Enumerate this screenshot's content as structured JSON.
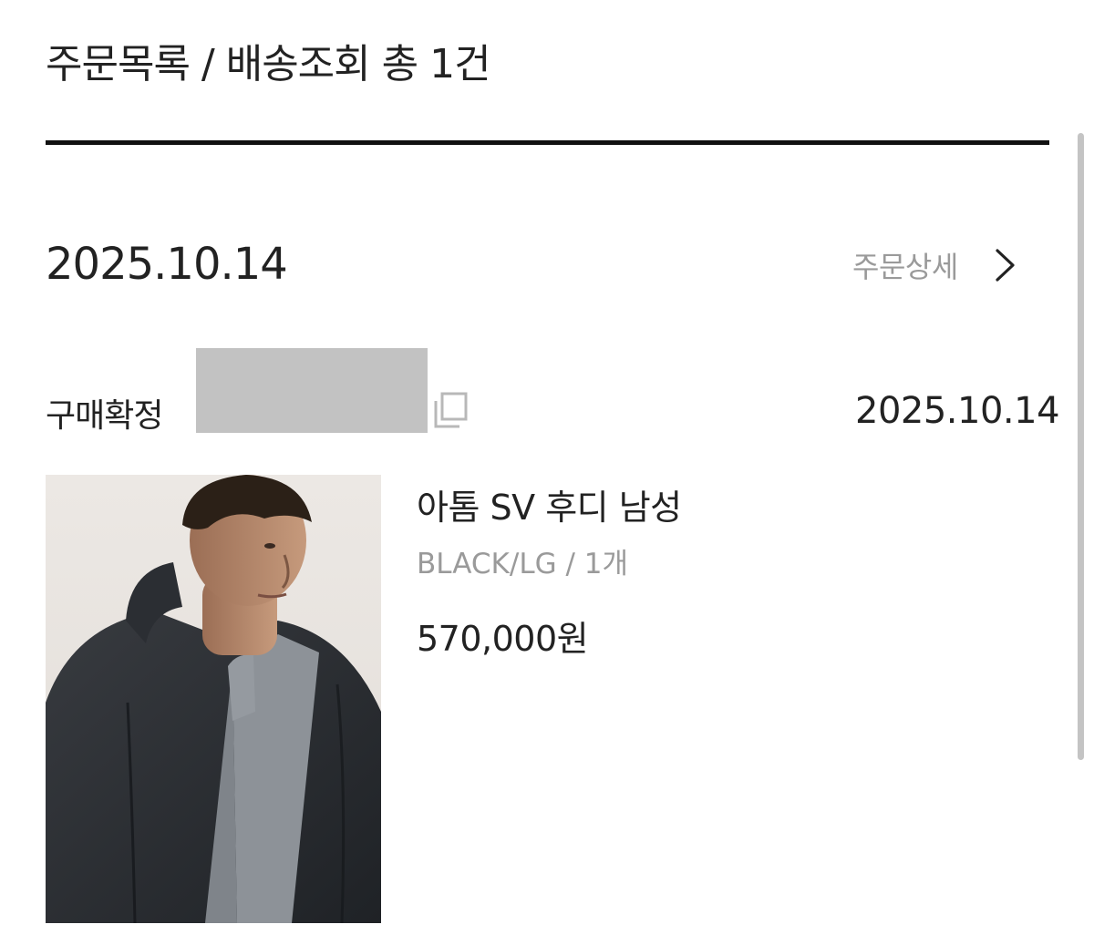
{
  "header": {
    "title": "주문목록 / 배송조회 총 1건"
  },
  "order": {
    "date": "2025.10.14",
    "detail_label": "주문상세",
    "status": "구매확정",
    "status_date": "2025.10.14",
    "product": {
      "name": "아톰 SV 후디 남성",
      "option": "BLACK/LG / 1개",
      "price": "570,000원"
    }
  },
  "icons": {
    "detail": "chevron-right-icon",
    "copy": "copy-icon"
  },
  "colors": {
    "text_primary": "#222222",
    "text_secondary": "#9a9a9a",
    "rule": "#111111",
    "redaction": "#c2c2c2"
  }
}
